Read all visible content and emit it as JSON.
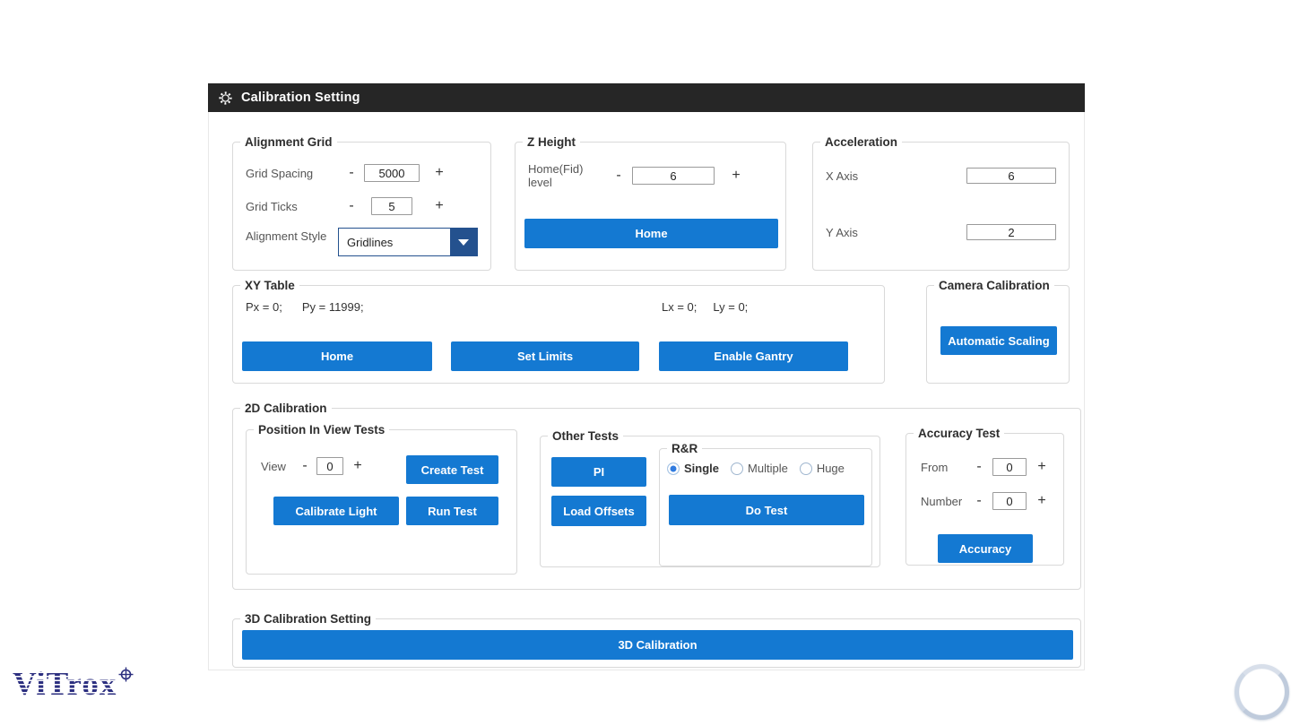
{
  "titlebar": {
    "title": "Calibration Setting"
  },
  "ui": {
    "minus": "-",
    "plus": "+"
  },
  "colors": {
    "accent": "#1479d2",
    "navy": "#24518e",
    "titlebar": "#262626",
    "logo_navy": "#2b2e7f"
  },
  "alignment_grid": {
    "title": "Alignment Grid",
    "grid_spacing": {
      "label": "Grid Spacing",
      "value": "5000"
    },
    "grid_ticks": {
      "label": "Grid Ticks",
      "value": "5"
    },
    "alignment_style": {
      "label": "Alignment Style",
      "value": "Gridlines"
    }
  },
  "z_height": {
    "title": "Z Height",
    "home_fid": {
      "label": "Home(Fid) level",
      "value": "6"
    },
    "home_button": "Home"
  },
  "acceleration": {
    "title": "Acceleration",
    "x_axis": {
      "label": "X Axis",
      "value": "6"
    },
    "y_axis": {
      "label": "Y Axis",
      "value": "2"
    }
  },
  "xy_table": {
    "title": "XY Table",
    "px": "Px = 0;",
    "py": "Py = 11999;",
    "lx": "Lx = 0;",
    "ly": "Ly = 0;",
    "home_button": "Home",
    "set_limits_button": "Set Limits",
    "enable_gantry_button": "Enable Gantry"
  },
  "camera_calibration": {
    "title": "Camera Calibration",
    "automatic_scaling_button": "Automatic Scaling"
  },
  "calibration_2d": {
    "title": "2D Calibration",
    "position_in_view": {
      "title": "Position In View Tests",
      "view": {
        "label": "View",
        "value": "0"
      },
      "create_test_button": "Create Test",
      "calibrate_light_button": "Calibrate Light",
      "run_test_button": "Run Test"
    },
    "other_tests": {
      "title": "Other Tests",
      "pi_button": "PI",
      "load_offsets_button": "Load Offsets",
      "rr": {
        "title": "R&R",
        "options": [
          {
            "label": "Single",
            "selected": true
          },
          {
            "label": "Multiple",
            "selected": false
          },
          {
            "label": "Huge",
            "selected": false
          }
        ],
        "do_test_button": "Do Test"
      }
    },
    "accuracy_test": {
      "title": "Accuracy Test",
      "from": {
        "label": "From",
        "value": "0"
      },
      "number": {
        "label": "Number",
        "value": "0"
      },
      "accuracy_button": "Accuracy"
    }
  },
  "calibration_3d": {
    "title": "3D Calibration Setting",
    "button": "3D Calibration"
  },
  "branding": {
    "logo_text": "ViTrox"
  }
}
